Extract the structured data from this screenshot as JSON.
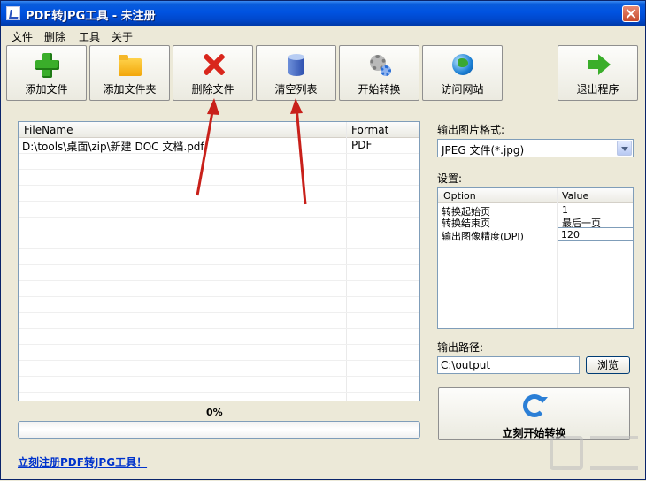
{
  "window": {
    "title": "PDF转JPG工具 - 未注册"
  },
  "menu": {
    "file": "文件",
    "delete": "删除",
    "tools": "工具",
    "about": "关于"
  },
  "toolbar": {
    "add_file": "添加文件",
    "add_folder": "添加文件夹",
    "delete_file": "删除文件",
    "clear_list": "清空列表",
    "start_convert": "开始转换",
    "visit_site": "访问网站",
    "exit": "退出程序"
  },
  "file_list": {
    "columns": [
      "FileName",
      "Format"
    ],
    "rows": [
      {
        "name": "D:\\tools\\桌面\\zip\\新建 DOC 文档.pdf",
        "format": "PDF"
      }
    ]
  },
  "progress": {
    "value_percent": 0,
    "label": "0%"
  },
  "register_link": "立刻注册PDF转JPG工具！",
  "output_format": {
    "label": "输出图片格式:",
    "selected": "JPEG 文件(*.jpg)"
  },
  "settings": {
    "label": "设置:",
    "columns": [
      "Option",
      "Value"
    ],
    "rows": [
      {
        "option": "转换起始页",
        "value": "1"
      },
      {
        "option": "转换结束页",
        "value": "最后一页"
      },
      {
        "option": "输出图像精度(DPI)",
        "value": "120"
      }
    ]
  },
  "output_path": {
    "label": "输出路径:",
    "value": "C:\\output",
    "browse": "浏览"
  },
  "convert_now": "立刻开始转换",
  "colors": {
    "title_bar": "#0053e1",
    "link": "#0033cc",
    "annotation_arrow": "#c8201a"
  }
}
